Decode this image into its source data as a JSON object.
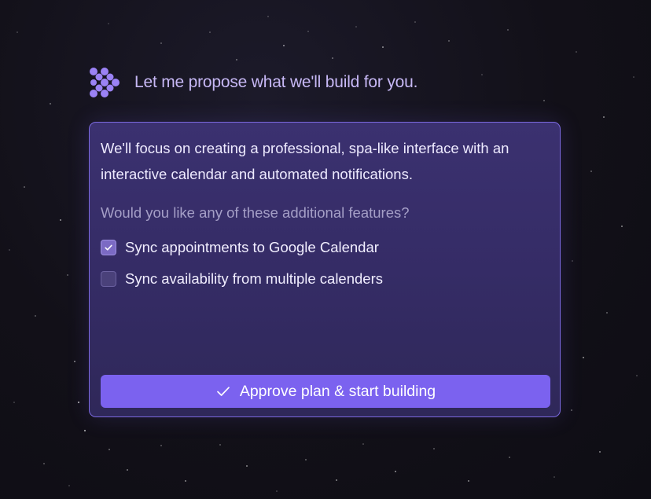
{
  "header": {
    "title": "Let me propose what we'll build for you."
  },
  "plan": {
    "description": "We'll focus on creating a professional, spa-like interface with an interactive calendar and automated notifications.",
    "question": "Would you like any of these additional features?",
    "options": [
      {
        "label": "Sync appointments to Google Calendar",
        "checked": true
      },
      {
        "label": "Sync availability from multiple calenders",
        "checked": false
      }
    ]
  },
  "actions": {
    "approve_label": "Approve plan & start building"
  },
  "colors": {
    "accent": "#7b62ef",
    "card_border": "#7b69df",
    "header_text": "#c7b8f5"
  }
}
